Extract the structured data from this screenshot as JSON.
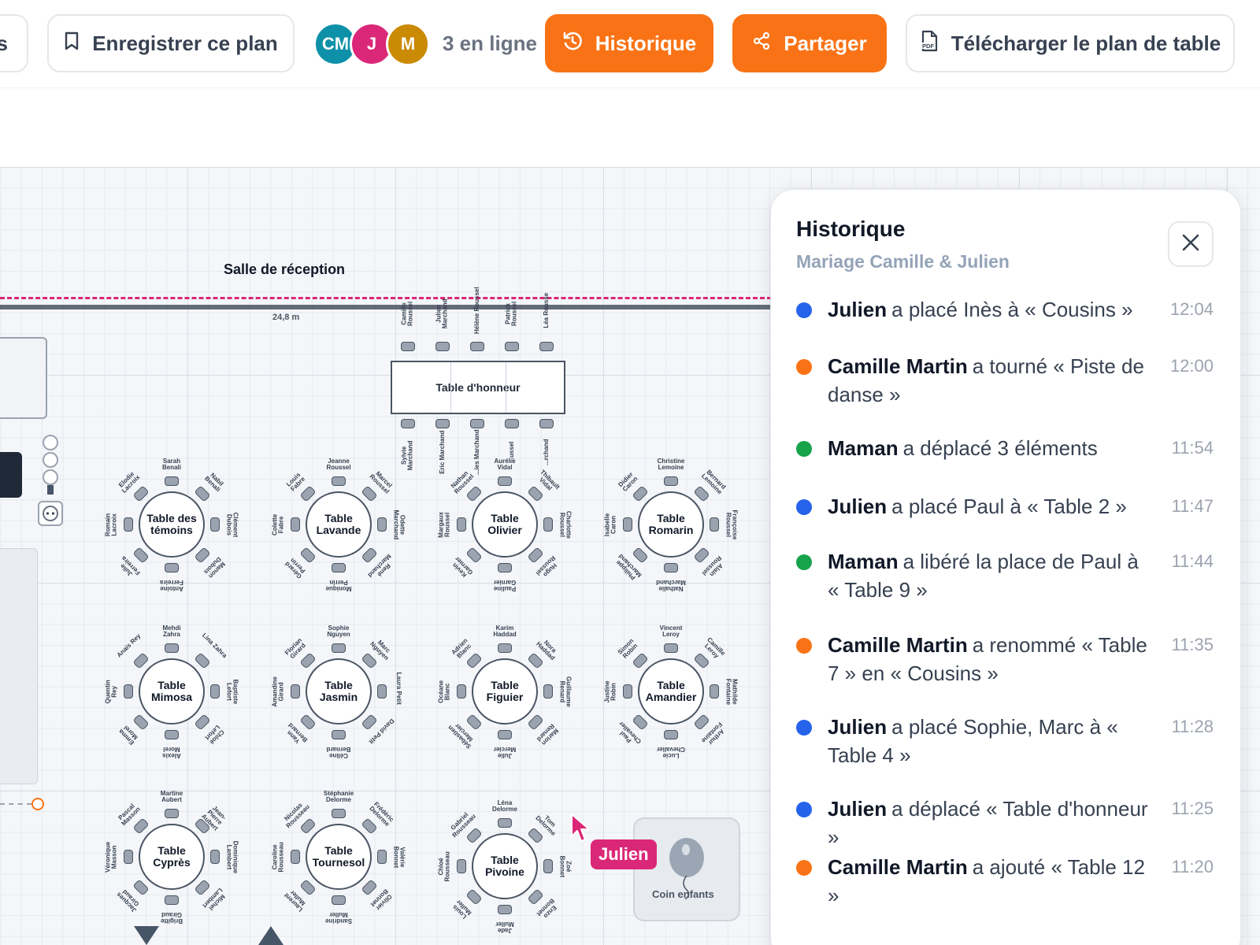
{
  "toolbar": {
    "left_fragment": "s",
    "save_label": "Enregistrer ce plan",
    "avatars": [
      {
        "initials": "CM",
        "color": "#0e91a8"
      },
      {
        "initials": "J",
        "color": "#db2777"
      },
      {
        "initials": "M",
        "color": "#ca8a04"
      }
    ],
    "online_label": "3 en ligne",
    "history_label": "Historique",
    "share_label": "Partager",
    "download_label": "Télécharger le plan de table",
    "accent": "#f97316"
  },
  "floor": {
    "room_title": "Salle de réception",
    "wall_length": "24,8 m",
    "honor_table": {
      "name": "Table d'honneur",
      "top_seats": [
        "Camille Roussel",
        "Julien Marchand",
        "Hélène Roussel",
        "Patrick Roussel",
        "Léa Rousse"
      ],
      "bottom_seats": [
        "Sylvie Marchand",
        "Eric Marchand",
        "...ies Marchand",
        "...ussel",
        "...rchand"
      ]
    },
    "round_tables": [
      {
        "name": "Table des témoins",
        "seats": [
          "Sarah Benali",
          "Nabil Benali",
          "Clément Dubois",
          "Manon Dubois",
          "Antoine Ferreira",
          "Julie Ferreira",
          "Romain Lacroix",
          "Elodie Lacroix"
        ]
      },
      {
        "name": "Table Lavande",
        "seats": [
          "Jeanne Roussel",
          "Marcel Roussel",
          "Odette Marchand",
          "René Marchand",
          "Monique Perrin",
          "Gérard Perrin",
          "Colette Fabre",
          "Louis Fabre"
        ]
      },
      {
        "name": "Table Olivier",
        "seats": [
          "Aurélie Vidal",
          "Thibault Vidal",
          "Charlotte Roussel",
          "Hugo Roussel",
          "Pauline Garnier",
          "Kevin Garnier",
          "Margaux Roussel",
          "Nathan Roussel"
        ]
      },
      {
        "name": "Table Romarin",
        "seats": [
          "Christine Lemoine",
          "Bernard Lemoine",
          "Françoise Roussel",
          "Alain Roussel",
          "Nathalie Marchand",
          "Philippe Marchand",
          "Isabelle Caron",
          "Didier Caron"
        ]
      },
      {
        "name": "Table Mimosa",
        "seats": [
          "Mehdi Zahra",
          "Lina Zahra",
          "Baptiste Lefort",
          "Chloé Lefort",
          "Alexis Morel",
          "Emma Morel",
          "Quentin Rey",
          "Anaïs Rey"
        ]
      },
      {
        "name": "Table Jasmin",
        "seats": [
          "Sophie Nguyen",
          "Marc Nguyen",
          "Laura Petit",
          "David Petit",
          "Céline Bernard",
          "Yann Bernard",
          "Amandine Girard",
          "Florian Girard"
        ]
      },
      {
        "name": "Table Figuier",
        "seats": [
          "Karim Haddad",
          "Nora Haddad",
          "Guillaume Renard",
          "Marion Renard",
          "Julie Mercier",
          "Sébastien Mercier",
          "Océane Blanc",
          "Adrien Blanc"
        ]
      },
      {
        "name": "Table Amandier",
        "seats": [
          "Vincent Leroy",
          "Camille Leroy",
          "Mathilde Fontaine",
          "Arthur Fontaine",
          "Lucie Chevalier",
          "Paul Chevalier",
          "Justine Robin",
          "Simon Robin"
        ]
      },
      {
        "name": "Table Cyprès",
        "seats": [
          "Martine Aubert",
          "Jean-Pierre Aubert",
          "Dominique Lambert",
          "Michel Lambert",
          "Brigitte Giraud",
          "Jacques Giraud",
          "Véronique Masson",
          "Pascal Masson"
        ]
      },
      {
        "name": "Table Tournesol",
        "seats": [
          "Stéphanie Delorme",
          "Frédéric Delorme",
          "Valérie Bonnet",
          "Olivier Bonnet",
          "Sandrine Muller",
          "Laurent Muller",
          "Caroline Rousseau",
          "Nicolas Rousseau"
        ]
      },
      {
        "name": "Table Pivoine",
        "seats": [
          "Léna Delorme",
          "Tom Delorme",
          "Zoé Bonnet",
          "Enzo Bonnet",
          "Jade Muller",
          "Louis Muller",
          "Chloé Rousseau",
          "Gabriel Rousseau"
        ]
      }
    ],
    "cursor_user": "Julien",
    "cursor_color": "#db2777",
    "kids_corner": "Coin enfants"
  },
  "history": {
    "title": "Historique",
    "subtitle": "Mariage Camille & Julien",
    "entries": [
      {
        "who": "Julien",
        "action": "a placé Inès à « Cousins »",
        "time": "12:04",
        "color": "#2563eb"
      },
      {
        "who": "Camille Martin",
        "action": "a tourné « Piste de danse »",
        "time": "12:00",
        "color": "#f97316"
      },
      {
        "who": "Maman",
        "action": "a déplacé 3 éléments",
        "time": "11:54",
        "color": "#16a34a"
      },
      {
        "who": "Julien",
        "action": "a placé Paul à « Table 2 »",
        "time": "11:47",
        "color": "#2563eb"
      },
      {
        "who": "Maman",
        "action": "a libéré la place de Paul à « Table 9 »",
        "time": "11:44",
        "color": "#16a34a"
      },
      {
        "who": "Camille Martin",
        "action": "a renommé « Table 7 » en « Cousins »",
        "time": "11:35",
        "color": "#f97316"
      },
      {
        "who": "Julien",
        "action": "a placé Sophie, Marc à « Table 4 »",
        "time": "11:28",
        "color": "#2563eb"
      },
      {
        "who": "Julien",
        "action": "a déplacé « Table d'honneur »",
        "time": "11:25",
        "color": "#2563eb"
      },
      {
        "who": "Camille Martin",
        "action": "a ajouté « Table 12 »",
        "time": "11:20",
        "color": "#f97316"
      }
    ]
  }
}
